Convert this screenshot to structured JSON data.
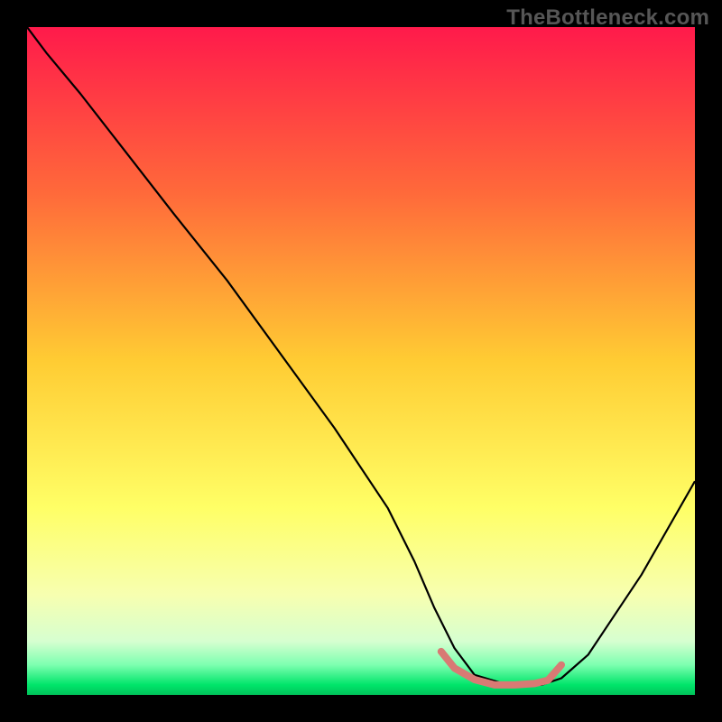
{
  "watermark": "TheBottleneck.com",
  "chart_data": {
    "type": "line",
    "title": "",
    "xlabel": "",
    "ylabel": "",
    "xlim": [
      0,
      100
    ],
    "ylim": [
      0,
      100
    ],
    "grid": false,
    "legend": false,
    "gradient_stops": [
      {
        "offset": 0,
        "color": "#ff1a4b"
      },
      {
        "offset": 0.25,
        "color": "#ff6a3a"
      },
      {
        "offset": 0.5,
        "color": "#ffcc33"
      },
      {
        "offset": 0.72,
        "color": "#ffff66"
      },
      {
        "offset": 0.85,
        "color": "#f7ffb0"
      },
      {
        "offset": 0.92,
        "color": "#d6ffd0"
      },
      {
        "offset": 0.955,
        "color": "#7dffb0"
      },
      {
        "offset": 0.985,
        "color": "#00e56a"
      },
      {
        "offset": 1.0,
        "color": "#00c25a"
      }
    ],
    "series": [
      {
        "name": "curve",
        "color": "#000000",
        "stroke_width": 2.2,
        "x": [
          0,
          3,
          8,
          15,
          22,
          30,
          38,
          46,
          54,
          58,
          61,
          64,
          67,
          72,
          77,
          80,
          84,
          88,
          92,
          96,
          100
        ],
        "y": [
          100,
          96,
          90,
          81,
          72,
          62,
          51,
          40,
          28,
          20,
          13,
          7,
          3,
          1.5,
          1.5,
          2.5,
          6,
          12,
          18,
          25,
          32
        ]
      },
      {
        "name": "highlight",
        "color": "#d87a74",
        "stroke_width": 8,
        "linecap": "round",
        "x": [
          62,
          64,
          67,
          70,
          73,
          76,
          78,
          80
        ],
        "y": [
          6.5,
          4,
          2.3,
          1.5,
          1.5,
          1.7,
          2.2,
          4.5
        ]
      }
    ]
  }
}
